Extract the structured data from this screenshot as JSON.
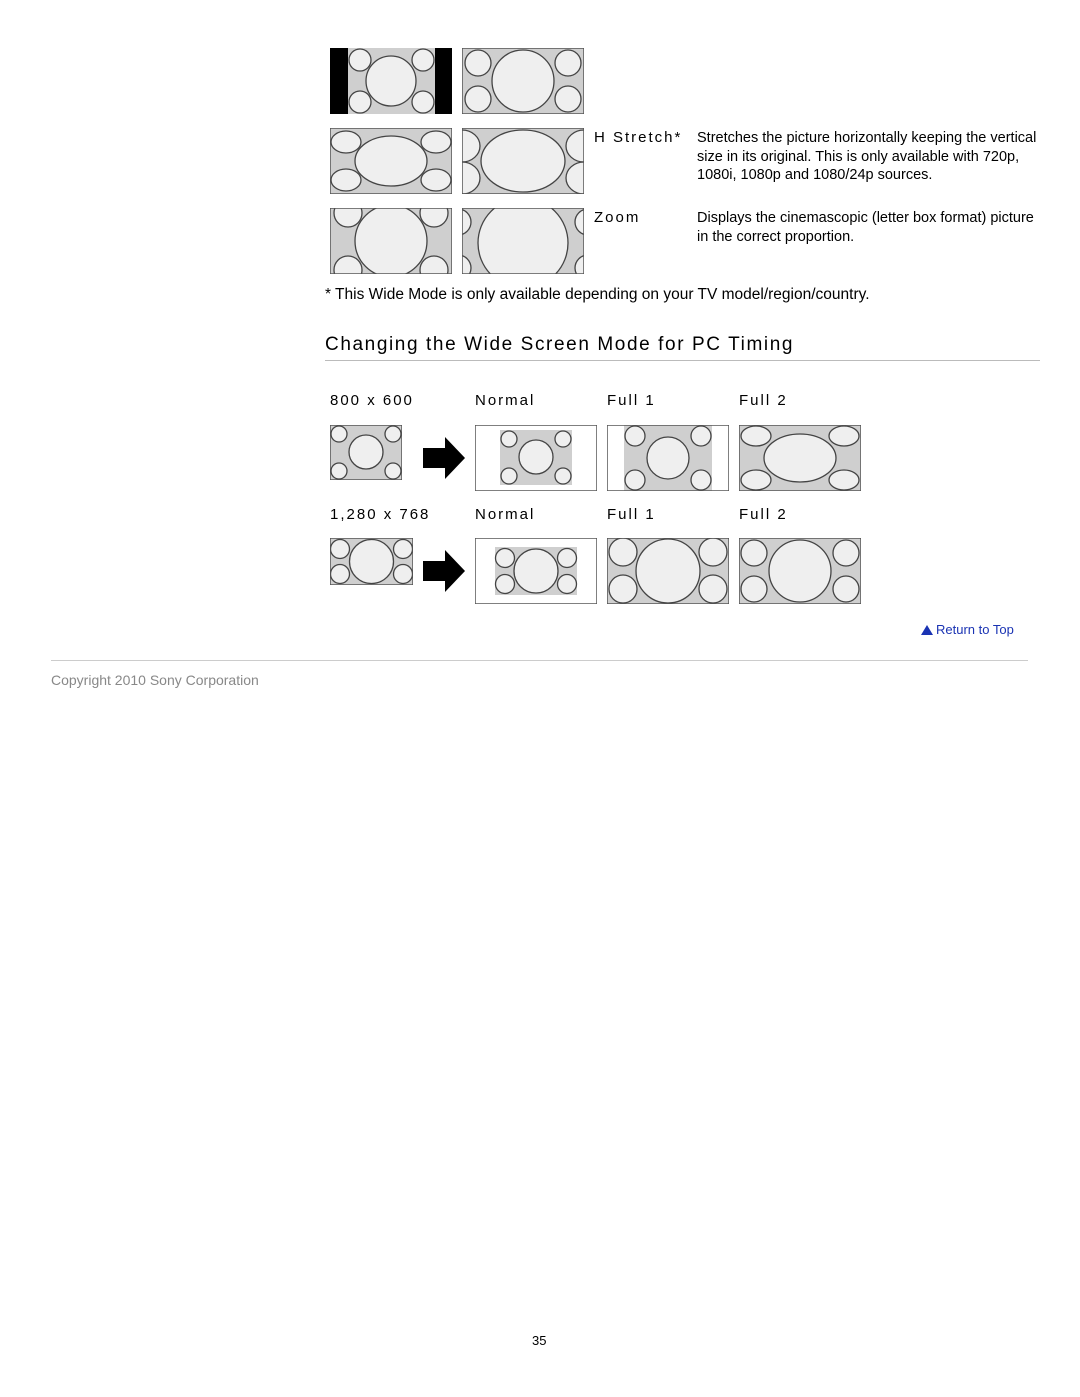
{
  "modes": [
    {
      "name": "H Stretch*",
      "description": "Stretches the picture horizontally keeping the vertical size in its original. This is only available with 720p, 1080i, 1080p and 1080/24p sources."
    },
    {
      "name": "Zoom",
      "description": "Displays the cinemascopic (letter box format) picture in the correct proportion."
    }
  ],
  "footnote": "* This Wide Mode is only available depending on your TV model/region/country.",
  "section_title": "Changing the Wide Screen Mode for PC Timing",
  "pc_rows": [
    {
      "resolution": "800 x 600",
      "modes": [
        "Normal",
        "Full 1",
        "Full 2"
      ]
    },
    {
      "resolution": "1,280 x 768",
      "modes": [
        "Normal",
        "Full 1",
        "Full 2"
      ]
    }
  ],
  "return_to_top": "Return to Top",
  "copyright": "Copyright 2010 Sony Corporation",
  "page_number": "35",
  "colors": {
    "link": "#1a33b3",
    "footer_text": "#888888",
    "rule": "#cccccc"
  },
  "icons": {
    "return": "triangle-up-icon",
    "arrow": "arrow-right-icon"
  }
}
